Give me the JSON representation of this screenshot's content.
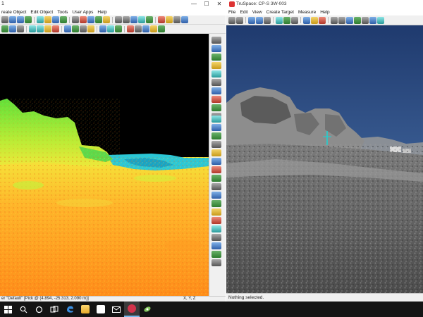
{
  "left_window": {
    "title": "1",
    "menu": [
      "reate Object",
      "Edit Object",
      "Tools",
      "User Apps",
      "Help"
    ],
    "window_controls": [
      "—",
      "☐",
      "✕"
    ],
    "status_text": "er \"Default\"  [Pick @ (4.894, -25.313, 2.090 m)]",
    "axes_label": "X, Y, Z"
  },
  "right_window": {
    "title": "TruSpace: CP-S 3W-003",
    "menu": [
      "File",
      "Edit",
      "View",
      "Create Target",
      "Measure",
      "Help"
    ],
    "status_text": "Nothing selected."
  },
  "taskbar": {
    "icons": [
      "windows-start",
      "search",
      "cortana-circle",
      "task-view",
      "edge",
      "file-explorer",
      "store",
      "mail",
      "media-app",
      "trimble-app"
    ]
  },
  "colors": {
    "window_bg": "#f0f0f0",
    "taskbar_bg": "#141414",
    "sky": "#2d4a7a",
    "accent": "#76b9ed"
  }
}
